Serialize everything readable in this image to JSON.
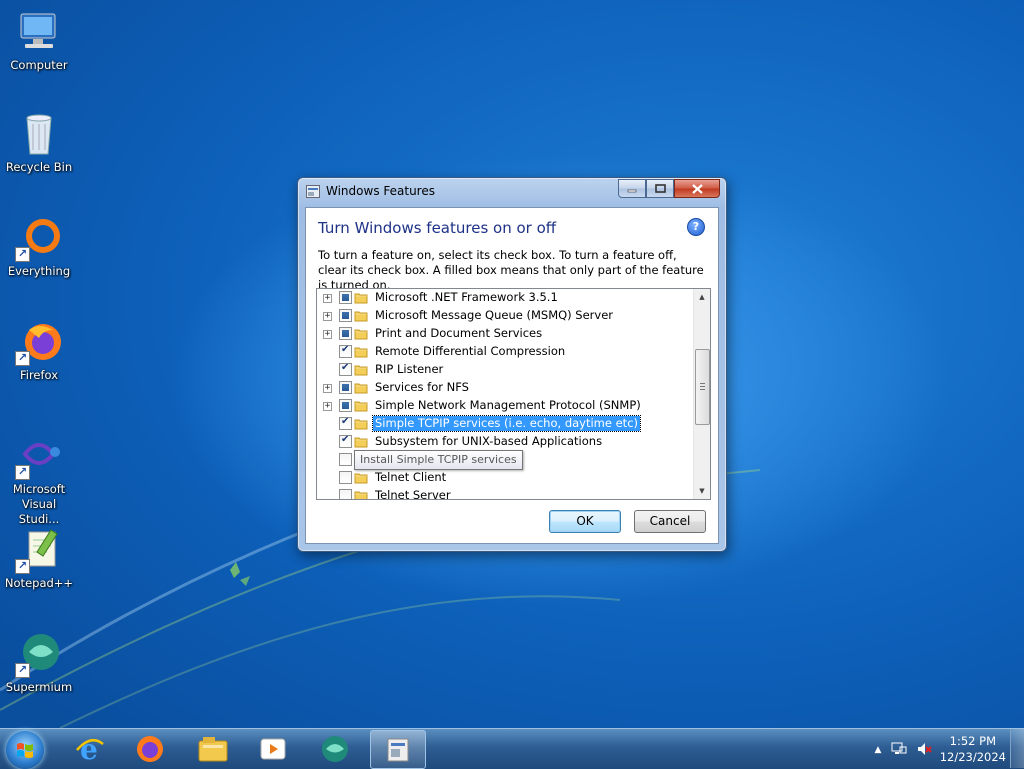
{
  "desktop": {
    "icons": [
      {
        "label": "Computer"
      },
      {
        "label": "Recycle Bin"
      },
      {
        "label": "Everything"
      },
      {
        "label": "Firefox"
      },
      {
        "label": "Microsoft Visual Studi..."
      },
      {
        "label": "Notepad++"
      },
      {
        "label": "Supermium"
      }
    ]
  },
  "window": {
    "title": "Windows Features",
    "heading": "Turn Windows features on or off",
    "help_glyph": "?",
    "description": "To turn a feature on, select its check box. To turn a feature off, clear its check box. A filled box means that only part of the feature is turned on.",
    "features": [
      {
        "label": "Microsoft .NET Framework 3.5.1",
        "state": "partial",
        "expandable": true
      },
      {
        "label": "Microsoft Message Queue (MSMQ) Server",
        "state": "partial",
        "expandable": true
      },
      {
        "label": "Print and Document Services",
        "state": "partial",
        "expandable": true
      },
      {
        "label": "Remote Differential Compression",
        "state": "checked",
        "expandable": false
      },
      {
        "label": "RIP Listener",
        "state": "checked",
        "expandable": false
      },
      {
        "label": "Services for NFS",
        "state": "partial",
        "expandable": true
      },
      {
        "label": "Simple Network Management Protocol (SNMP)",
        "state": "partial",
        "expandable": true
      },
      {
        "label": "Simple TCPIP services (i.e. echo, daytime etc)",
        "state": "checked",
        "expandable": false,
        "selected": true
      },
      {
        "label": "Subsystem for UNIX-based Applications",
        "state": "checked",
        "expandable": false
      },
      {
        "label": "",
        "state": "unchecked",
        "expandable": false
      },
      {
        "label": "Telnet Client",
        "state": "unchecked",
        "expandable": false
      },
      {
        "label": "Telnet Server",
        "state": "unchecked",
        "expandable": false
      }
    ],
    "tooltip": "Install Simple TCPIP services",
    "ok_label": "OK",
    "cancel_label": "Cancel"
  },
  "taskbar": {
    "pinned": [
      "internet-explorer",
      "firefox",
      "file-explorer",
      "media-player",
      "supermium",
      "windows-features"
    ],
    "clock_time": "1:52 PM",
    "clock_date": "12/23/2024"
  },
  "colors": {
    "selection": "#3399ff",
    "heading": "#1e3287",
    "taskbar": "#2d5d93"
  }
}
